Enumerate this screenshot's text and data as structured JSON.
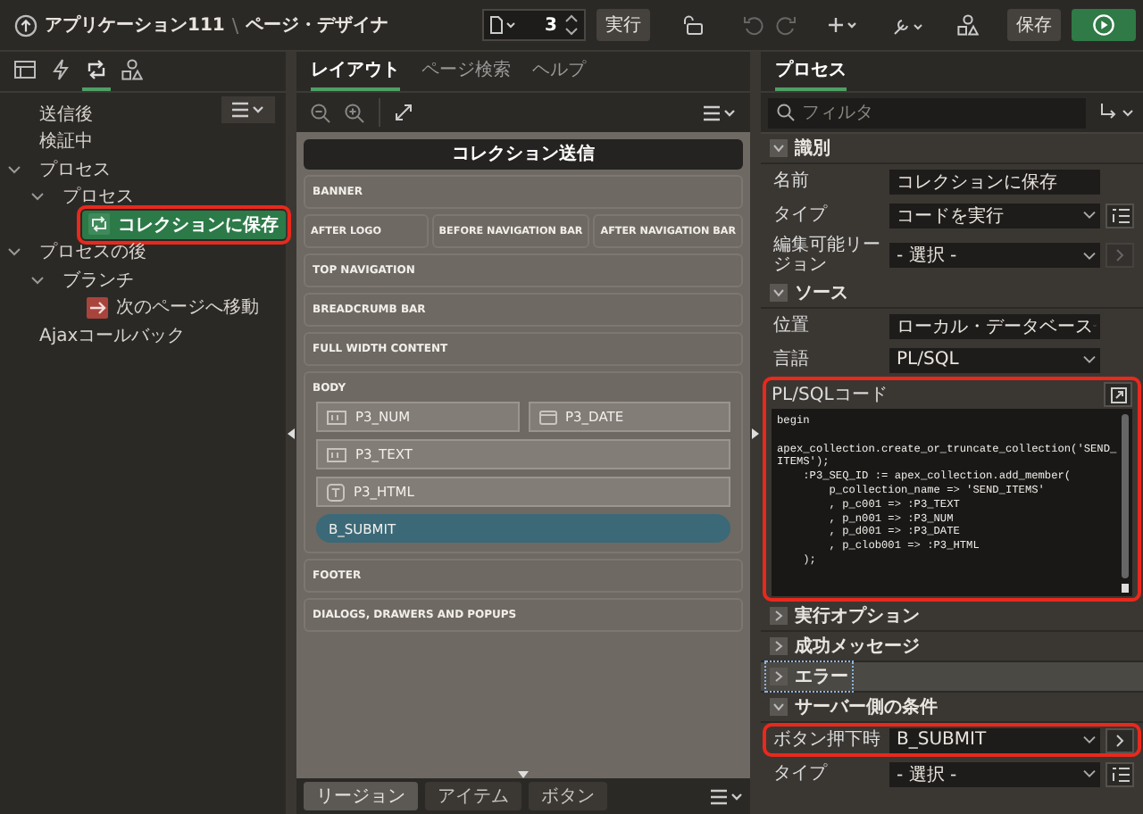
{
  "header": {
    "app": "アプリケーション111",
    "separator": "\\",
    "page": "ページ・デザイナ",
    "page_number": "3",
    "run_label": "実行",
    "save_label": "保存"
  },
  "left_tabs": [
    {
      "kind": "grid",
      "selected": false
    },
    {
      "kind": "bolt",
      "selected": false
    },
    {
      "kind": "loop",
      "selected": true
    },
    {
      "kind": "shapes",
      "selected": false
    }
  ],
  "tree": [
    {
      "label": "送信後",
      "selected": false
    },
    {
      "label": "検証中",
      "selected": false
    },
    {
      "label": "プロセス",
      "selected": false,
      "expanded": true,
      "children": [
        {
          "label": "プロセス",
          "selected": false,
          "expanded": true,
          "children": [
            {
              "label": "コレクションに保存",
              "kind": "process",
              "selected": true,
              "highlighted": true
            }
          ]
        }
      ]
    },
    {
      "label": "プロセスの後",
      "selected": false,
      "expanded": true,
      "children": [
        {
          "label": "ブランチ",
          "selected": false,
          "expanded": true,
          "children": [
            {
              "label": "次のページへ移動",
              "kind": "branch",
              "selected": false,
              "highlighted": false
            }
          ]
        }
      ]
    },
    {
      "label": "Ajaxコールバック",
      "selected": false
    }
  ],
  "center_tabs": [
    {
      "label": "レイアウト",
      "selected": true
    },
    {
      "label": "ページ検索",
      "selected": false
    },
    {
      "label": "ヘルプ",
      "selected": false
    }
  ],
  "layout": {
    "page_title": "コレクション送信",
    "regions": [
      {
        "kind": "region",
        "label": "BANNER"
      },
      {
        "kind": "split",
        "labels": [
          "AFTER LOGO",
          "BEFORE NAVIGATION BAR",
          "AFTER NAVIGATION BAR"
        ]
      },
      {
        "kind": "region",
        "label": "TOP NAVIGATION"
      },
      {
        "kind": "region",
        "label": "BREADCRUMB BAR"
      },
      {
        "kind": "region",
        "label": "FULL WIDTH CONTENT"
      },
      {
        "kind": "region",
        "label": "BODY",
        "rows": [
          [
            {
              "label": "P3_NUM",
              "kind": "number"
            },
            {
              "label": "P3_DATE",
              "kind": "date"
            }
          ],
          [
            {
              "label": "P3_TEXT",
              "kind": "text"
            }
          ],
          [
            {
              "label": "P3_HTML",
              "kind": "html"
            }
          ],
          [
            {
              "label": "B_SUBMIT",
              "kind": "button"
            }
          ]
        ]
      },
      {
        "kind": "region",
        "label": "FOOTER"
      },
      {
        "kind": "region",
        "label": "DIALOGS, DRAWERS AND POPUPS"
      }
    ]
  },
  "gallery_tabs": [
    {
      "label": "リージョン",
      "selected": true
    },
    {
      "label": "アイテム",
      "selected": false
    },
    {
      "label": "ボタン",
      "selected": false
    }
  ],
  "right_tabs": [
    {
      "label": "プロセス",
      "selected": true
    }
  ],
  "filter": {
    "placeholder": "フィルタ"
  },
  "sections": [
    {
      "title": "識別",
      "expanded": true,
      "focused": false,
      "fields": [
        {
          "label": "名前",
          "kind": "text",
          "value": "コレクションに保存",
          "highlighted": false
        },
        {
          "label": "タイプ",
          "kind": "select",
          "value": "コードを実行",
          "side": {
            "kind": "list",
            "disabled": false
          },
          "highlighted": false
        },
        {
          "label": "編集可能リージョン",
          "kind": "select",
          "value": "- 選択 -",
          "side": {
            "kind": "go",
            "disabled": true
          },
          "highlighted": false
        }
      ]
    },
    {
      "title": "ソース",
      "expanded": true,
      "focused": false,
      "fields": [
        {
          "label": "位置",
          "kind": "select",
          "value": "ローカル・データベース",
          "highlighted": false
        },
        {
          "label": "言語",
          "kind": "select",
          "value": "PL/SQL",
          "highlighted": false
        },
        {
          "label": "PL/SQLコード",
          "kind": "code",
          "value": "begin\n\napex_collection.create_or_truncate_collection('SEND_\nITEMS');\n    :P3_SEQ_ID := apex_collection.add_member(\n        p_collection_name => 'SEND_ITEMS'\n        , p_c001 => :P3_TEXT\n        , p_n001 => :P3_NUM\n        , p_d001 => :P3_DATE\n        , p_clob001 => :P3_HTML\n    );",
          "highlighted": true
        }
      ]
    },
    {
      "title": "実行オプション",
      "expanded": false,
      "focused": false
    },
    {
      "title": "成功メッセージ",
      "expanded": false,
      "focused": false
    },
    {
      "title": "エラー",
      "expanded": false,
      "focused": true
    },
    {
      "title": "サーバー側の条件",
      "expanded": true,
      "focused": false,
      "fields": [
        {
          "label": "ボタン押下時",
          "kind": "select",
          "value": "B_SUBMIT",
          "side": {
            "kind": "go",
            "disabled": false
          },
          "highlighted": true
        },
        {
          "label": "タイプ",
          "kind": "select",
          "value": "- 選択 -",
          "side": {
            "kind": "list",
            "disabled": false
          },
          "highlighted": false
        }
      ]
    }
  ]
}
